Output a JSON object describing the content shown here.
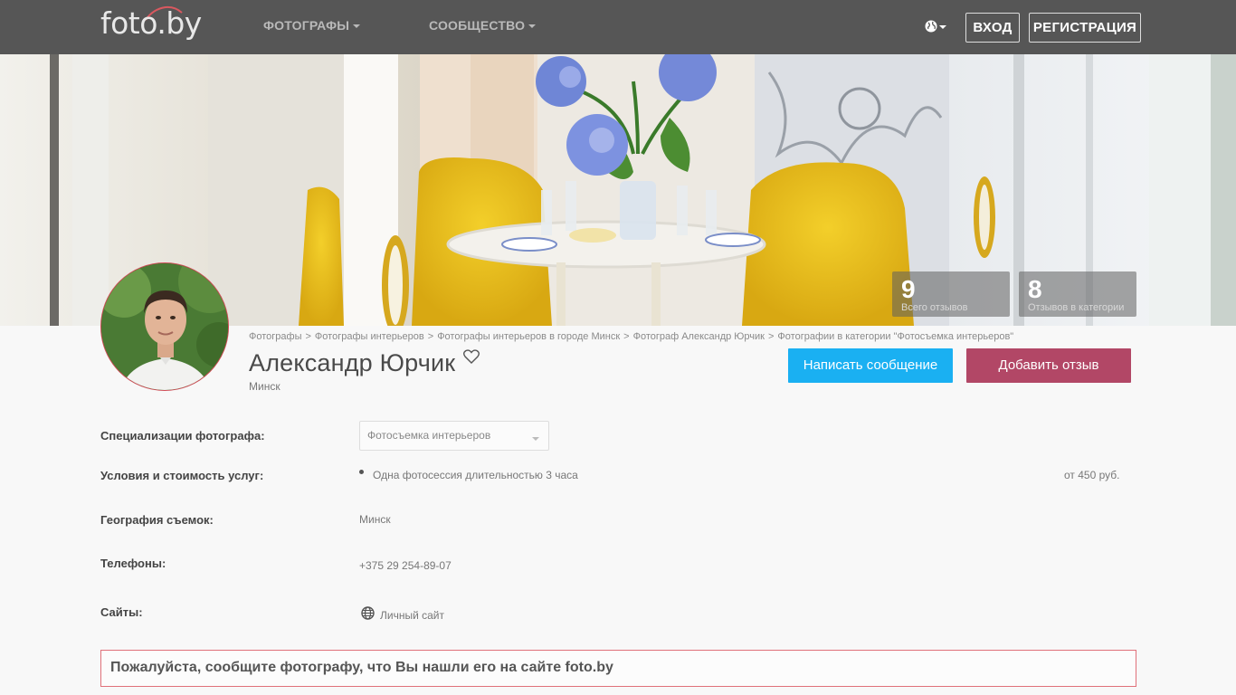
{
  "header": {
    "logo": "foto.by",
    "nav": [
      {
        "label": "ФОТОГРАФЫ"
      },
      {
        "label": "СООБЩЕСТВО"
      }
    ],
    "login_label": "ВХОД",
    "register_label": "РЕГИСТРАЦИЯ"
  },
  "stats": [
    {
      "value": "9",
      "label": "Всего отзывов"
    },
    {
      "value": "8",
      "label": "Отзывов в категории"
    }
  ],
  "breadcrumb": [
    "Фотографы",
    "Фотографы интерьеров",
    "Фотографы интерьеров в городе Минск",
    "Фотограф Александр Юрчик",
    "Фотографии в категории \"Фотосъемка интерьеров\""
  ],
  "breadcrumb_separator": ">",
  "profile": {
    "name": "Александр Юрчик",
    "city": "Минск",
    "message_button": "Написать сообщение",
    "review_button": "Добавить отзыв"
  },
  "details": {
    "specializations_label": "Специализации фотографа:",
    "specialization_selected": "Фотосъемка интерьеров",
    "services_label": "Условия и стоимость услуг:",
    "service_item": "Одна фотосессия длительностью 3 часа",
    "service_price": "от 450 руб.",
    "geography_label": "География съемок:",
    "geography_value": "Минск",
    "phones_label": "Телефоны:",
    "phone_value": "+375 29 254-89-07",
    "sites_label": "Сайты:",
    "site_value": "Личный сайт"
  },
  "notice": "Пожалуйста, сообщите фотографу, что Вы нашли его на сайте foto.by",
  "colors": {
    "topbar": "#565656",
    "message_button": "#1ab0f2",
    "review_button": "#b24766",
    "notice_border": "#e0717a"
  }
}
